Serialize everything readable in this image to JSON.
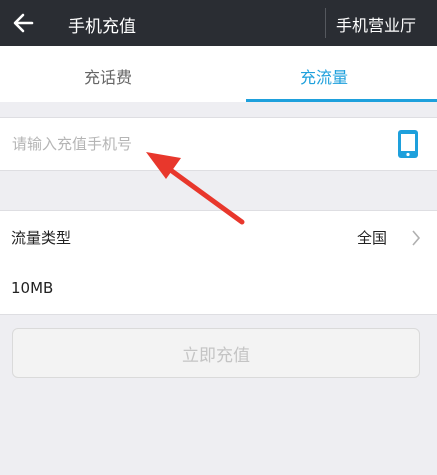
{
  "header": {
    "title": "手机充值",
    "right_label": "手机营业厅",
    "back_icon": "back-arrow-icon"
  },
  "tabs": [
    {
      "label": "充话费",
      "active": false
    },
    {
      "label": "充流量",
      "active": true
    }
  ],
  "phone": {
    "value": "",
    "placeholder": "请输入充值手机号",
    "contacts_icon": "phone-icon"
  },
  "flow_type": {
    "label": "流量类型",
    "value": "全国"
  },
  "amount": {
    "value": "10MB"
  },
  "submit": {
    "label": "立即充值"
  },
  "colors": {
    "header_bg": "#2a2d33",
    "accent": "#1ea0dc",
    "annotation_arrow": "#e8372c"
  }
}
